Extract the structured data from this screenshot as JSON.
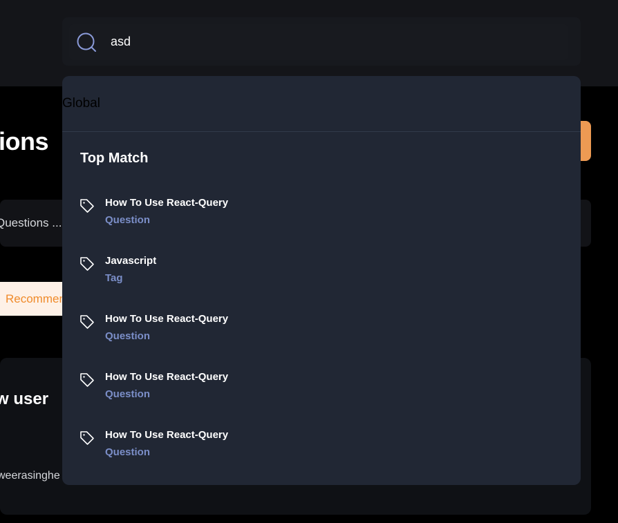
{
  "search": {
    "value": "asd"
  },
  "background": {
    "page_title": "ions",
    "search_placeholder": "Questions ...",
    "filter_label": "Recommended",
    "card_title": "w user",
    "card_user": "weerasinghe"
  },
  "dropdown": {
    "filter_label": "Global",
    "section_title": "Top Match",
    "results": [
      {
        "title": "How To Use React-Query",
        "type": "Question"
      },
      {
        "title": "Javascript",
        "type": "Tag"
      },
      {
        "title": "How To Use React-Query",
        "type": "Question"
      },
      {
        "title": "How To Use React-Query",
        "type": "Question"
      },
      {
        "title": "How To Use React-Query",
        "type": "Question"
      }
    ]
  },
  "colors": {
    "accent": "#ed9a53",
    "dropdown_bg": "#212734",
    "type_text": "#7b8ec8"
  },
  "icons": {
    "search": "search-icon",
    "result": "tag-icon"
  }
}
